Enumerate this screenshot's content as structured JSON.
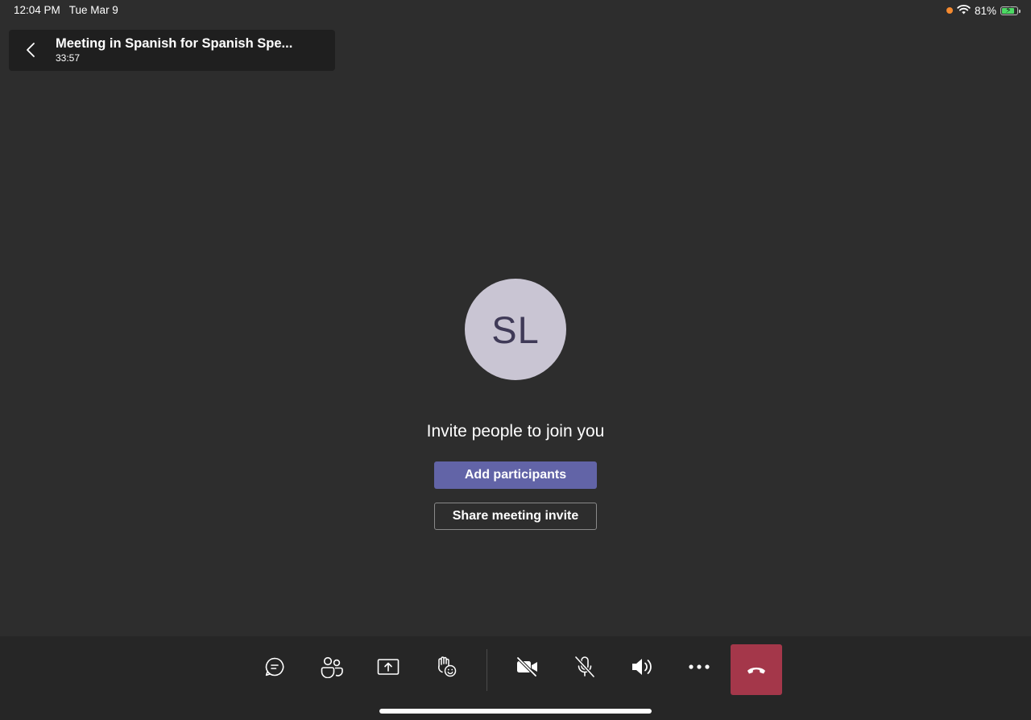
{
  "status_bar": {
    "time": "12:04 PM",
    "date": "Tue Mar 9",
    "battery_percent": "81%",
    "battery_level": 0.81,
    "wifi_icon": "wifi-icon",
    "recording_dot_color": "#f58a2f"
  },
  "header": {
    "title": "Meeting in Spanish for Spanish Spe...",
    "duration": "33:57",
    "back_icon": "chevron-left-icon"
  },
  "main": {
    "avatar_initials": "SL",
    "invite_prompt": "Invite people to join you",
    "add_participants_label": "Add participants",
    "share_invite_label": "Share meeting invite"
  },
  "toolbar": {
    "items": [
      {
        "name": "chat",
        "icon": "chat-icon"
      },
      {
        "name": "participants",
        "icon": "people-icon"
      },
      {
        "name": "share",
        "icon": "share-screen-icon"
      },
      {
        "name": "reactions",
        "icon": "raise-hand-icon"
      },
      {
        "name": "camera",
        "icon": "camera-off-icon"
      },
      {
        "name": "microphone",
        "icon": "mic-off-icon"
      },
      {
        "name": "speaker",
        "icon": "speaker-icon"
      },
      {
        "name": "more",
        "icon": "more-icon"
      },
      {
        "name": "hang-up",
        "icon": "hang-up-icon"
      }
    ]
  },
  "colors": {
    "background": "#2d2d2d",
    "header_bg": "#1f1f1f",
    "toolbar_bg": "#262626",
    "primary_button": "#6264a7",
    "end_call": "#a4374a",
    "avatar_bg": "#c9c5d3",
    "avatar_text": "#3f3a57"
  }
}
